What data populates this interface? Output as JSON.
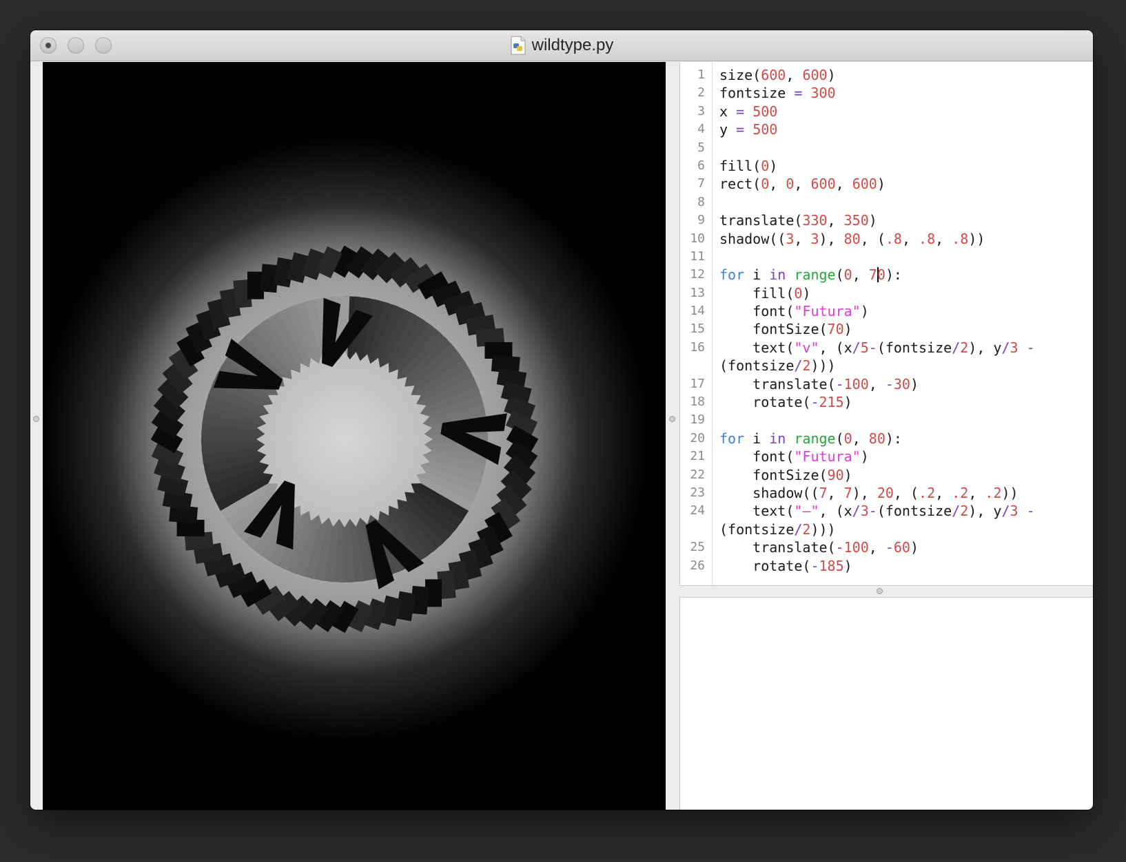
{
  "window": {
    "title": "wildtype.py"
  },
  "editor": {
    "lines": [
      {
        "n": "1",
        "src": [
          [
            "fn0",
            "size("
          ],
          [
            "num",
            "600"
          ],
          [
            "p",
            ", "
          ],
          [
            "num",
            "600"
          ],
          [
            "p",
            ")"
          ]
        ]
      },
      {
        "n": "2",
        "src": [
          [
            "p",
            "fontsize "
          ],
          [
            "op",
            "="
          ],
          [
            "p",
            " "
          ],
          [
            "num",
            "300"
          ]
        ]
      },
      {
        "n": "3",
        "src": [
          [
            "p",
            "x "
          ],
          [
            "op",
            "="
          ],
          [
            "p",
            " "
          ],
          [
            "num",
            "500"
          ]
        ]
      },
      {
        "n": "4",
        "src": [
          [
            "p",
            "y "
          ],
          [
            "op",
            "="
          ],
          [
            "p",
            " "
          ],
          [
            "num",
            "500"
          ]
        ]
      },
      {
        "n": "5",
        "src": []
      },
      {
        "n": "6",
        "src": [
          [
            "p",
            "fill("
          ],
          [
            "num",
            "0"
          ],
          [
            "p",
            ")"
          ]
        ]
      },
      {
        "n": "7",
        "src": [
          [
            "p",
            "rect("
          ],
          [
            "num",
            "0"
          ],
          [
            "p",
            ", "
          ],
          [
            "num",
            "0"
          ],
          [
            "p",
            ", "
          ],
          [
            "num",
            "600"
          ],
          [
            "p",
            ", "
          ],
          [
            "num",
            "600"
          ],
          [
            "p",
            ")"
          ]
        ]
      },
      {
        "n": "8",
        "src": []
      },
      {
        "n": "9",
        "src": [
          [
            "p",
            "translate("
          ],
          [
            "num",
            "330"
          ],
          [
            "p",
            ", "
          ],
          [
            "num",
            "350"
          ],
          [
            "p",
            ")"
          ]
        ]
      },
      {
        "n": "10",
        "src": [
          [
            "p",
            "shadow(("
          ],
          [
            "num",
            "3"
          ],
          [
            "p",
            ", "
          ],
          [
            "num",
            "3"
          ],
          [
            "p",
            "), "
          ],
          [
            "num",
            "80"
          ],
          [
            "p",
            ", ("
          ],
          [
            "num",
            ".8"
          ],
          [
            "p",
            ", "
          ],
          [
            "num",
            ".8"
          ],
          [
            "p",
            ", "
          ],
          [
            "num",
            ".8"
          ],
          [
            "p",
            "))"
          ]
        ]
      },
      {
        "n": "11",
        "src": []
      },
      {
        "n": "12",
        "src": [
          [
            "kw",
            "for"
          ],
          [
            "p",
            " i "
          ],
          [
            "kw2",
            "in"
          ],
          [
            "p",
            " "
          ],
          [
            "fn",
            "range"
          ],
          [
            "p",
            "("
          ],
          [
            "num",
            "0"
          ],
          [
            "p",
            ", "
          ],
          [
            "num",
            "7"
          ],
          [
            "caret",
            ""
          ],
          [
            "num",
            "0"
          ],
          [
            "p",
            "):"
          ]
        ]
      },
      {
        "n": "13",
        "src": [
          [
            "p",
            "    fill("
          ],
          [
            "num",
            "0"
          ],
          [
            "p",
            ")"
          ]
        ]
      },
      {
        "n": "14",
        "src": [
          [
            "p",
            "    font("
          ],
          [
            "str",
            "\"Futura\""
          ],
          [
            "p",
            ")"
          ]
        ]
      },
      {
        "n": "15",
        "src": [
          [
            "p",
            "    fontSize("
          ],
          [
            "num",
            "70"
          ],
          [
            "p",
            ")"
          ]
        ]
      },
      {
        "n": "16",
        "src": [
          [
            "p",
            "    text("
          ],
          [
            "str",
            "\"v\""
          ],
          [
            "p",
            ", (x"
          ],
          [
            "op",
            "/"
          ],
          [
            "num",
            "5"
          ],
          [
            "op",
            "-"
          ],
          [
            "p",
            "(fontsize"
          ],
          [
            "op",
            "/"
          ],
          [
            "num",
            "2"
          ],
          [
            "p",
            "), y"
          ],
          [
            "op",
            "/"
          ],
          [
            "num",
            "3"
          ],
          [
            "p",
            " "
          ],
          [
            "op",
            "-"
          ]
        ]
      },
      {
        "n": "",
        "src": [
          [
            "p",
            "(fontsize"
          ],
          [
            "op",
            "/"
          ],
          [
            "num",
            "2"
          ],
          [
            "p",
            ")))"
          ]
        ]
      },
      {
        "n": "17",
        "src": [
          [
            "p",
            "    translate("
          ],
          [
            "op",
            "-"
          ],
          [
            "num",
            "100"
          ],
          [
            "p",
            ", "
          ],
          [
            "op",
            "-"
          ],
          [
            "num",
            "30"
          ],
          [
            "p",
            ")"
          ]
        ]
      },
      {
        "n": "18",
        "src": [
          [
            "p",
            "    rotate("
          ],
          [
            "op",
            "-"
          ],
          [
            "num",
            "215"
          ],
          [
            "p",
            ")"
          ]
        ]
      },
      {
        "n": "19",
        "src": []
      },
      {
        "n": "20",
        "src": [
          [
            "kw",
            "for"
          ],
          [
            "p",
            " i "
          ],
          [
            "kw2",
            "in"
          ],
          [
            "p",
            " "
          ],
          [
            "fn",
            "range"
          ],
          [
            "p",
            "("
          ],
          [
            "num",
            "0"
          ],
          [
            "p",
            ", "
          ],
          [
            "num",
            "80"
          ],
          [
            "p",
            "):"
          ]
        ]
      },
      {
        "n": "21",
        "src": [
          [
            "p",
            "    font("
          ],
          [
            "str",
            "\"Futura\""
          ],
          [
            "p",
            ")"
          ]
        ]
      },
      {
        "n": "22",
        "src": [
          [
            "p",
            "    fontSize("
          ],
          [
            "num",
            "90"
          ],
          [
            "p",
            ")"
          ]
        ]
      },
      {
        "n": "23",
        "src": [
          [
            "p",
            "    shadow(("
          ],
          [
            "num",
            "7"
          ],
          [
            "p",
            ", "
          ],
          [
            "num",
            "7"
          ],
          [
            "p",
            "), "
          ],
          [
            "num",
            "20"
          ],
          [
            "p",
            ", ("
          ],
          [
            "num",
            ".2"
          ],
          [
            "p",
            ", "
          ],
          [
            "num",
            ".2"
          ],
          [
            "p",
            ", "
          ],
          [
            "num",
            ".2"
          ],
          [
            "p",
            "))"
          ]
        ]
      },
      {
        "n": "24",
        "src": [
          [
            "p",
            "    text("
          ],
          [
            "str",
            "\"–\""
          ],
          [
            "p",
            ", (x"
          ],
          [
            "op",
            "/"
          ],
          [
            "num",
            "3"
          ],
          [
            "op",
            "-"
          ],
          [
            "p",
            "(fontsize"
          ],
          [
            "op",
            "/"
          ],
          [
            "num",
            "2"
          ],
          [
            "p",
            "), y"
          ],
          [
            "op",
            "/"
          ],
          [
            "num",
            "3"
          ],
          [
            "p",
            " "
          ],
          [
            "op",
            "-"
          ]
        ]
      },
      {
        "n": "",
        "src": [
          [
            "p",
            "(fontsize"
          ],
          [
            "op",
            "/"
          ],
          [
            "num",
            "2"
          ],
          [
            "p",
            ")))"
          ]
        ]
      },
      {
        "n": "25",
        "src": [
          [
            "p",
            "    translate("
          ],
          [
            "op",
            "-"
          ],
          [
            "num",
            "100"
          ],
          [
            "p",
            ", "
          ],
          [
            "op",
            "-"
          ],
          [
            "num",
            "60"
          ],
          [
            "p",
            ")"
          ]
        ]
      },
      {
        "n": "26",
        "src": [
          [
            "p",
            "    rotate("
          ],
          [
            "op",
            "-"
          ],
          [
            "num",
            "185"
          ],
          [
            "p",
            ")"
          ]
        ]
      }
    ]
  },
  "output": {
    "text": ""
  },
  "colors": {
    "keyword": "#3d7fe0",
    "number": "#d04a4a",
    "string": "#e03bd6",
    "builtin": "#28a53a",
    "operator": "#7a3fc4"
  }
}
